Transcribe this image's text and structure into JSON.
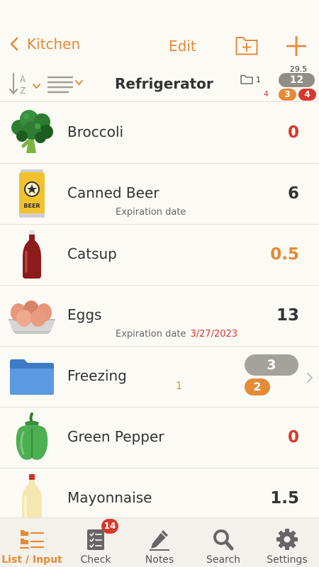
{
  "nav": {
    "back_label": "Kitchen",
    "edit_label": "Edit"
  },
  "header": {
    "title": "Refrigerator",
    "folder_count": "1",
    "total": "29.5",
    "gray_count": "12",
    "red_text_count": "4",
    "orange_count": "3",
    "red_count": "4"
  },
  "items": [
    {
      "name": "Broccoli",
      "qty": "0",
      "qty_color": "red",
      "icon": "broccoli-icon"
    },
    {
      "name": "Canned Beer",
      "qty": "6",
      "qty_color": "dark",
      "icon": "beer-can-icon",
      "exp_label": "Expiration date",
      "exp_date": ""
    },
    {
      "name": "Catsup",
      "qty": "0.5",
      "qty_color": "orange",
      "icon": "catsup-bottle-icon"
    },
    {
      "name": "Eggs",
      "qty": "13",
      "qty_color": "dark",
      "icon": "eggs-icon",
      "exp_label": "Expiration date",
      "exp_date": "3/27/2023"
    },
    {
      "name": "Freezing",
      "type": "folder",
      "icon": "folder-icon",
      "folder_total": "3",
      "folder_orange": "2",
      "folder_sub": "1"
    },
    {
      "name": "Green Pepper",
      "qty": "0",
      "qty_color": "red",
      "icon": "green-pepper-icon"
    },
    {
      "name": "Mayonnaise",
      "qty": "1.5",
      "qty_color": "dark",
      "icon": "mayonnaise-bottle-icon"
    }
  ],
  "tabs": [
    {
      "label": "List / Input",
      "icon": "list-input-icon",
      "active": true
    },
    {
      "label": "Check",
      "icon": "checklist-icon",
      "badge": "14"
    },
    {
      "label": "Notes",
      "icon": "pencil-icon"
    },
    {
      "label": "Search",
      "icon": "search-icon"
    },
    {
      "label": "Settings",
      "icon": "gear-icon"
    }
  ],
  "colors": {
    "accent": "#e58a35",
    "alert": "#d7392f",
    "pill_gray": "#8f8e87",
    "background": "#fbfaf5"
  }
}
